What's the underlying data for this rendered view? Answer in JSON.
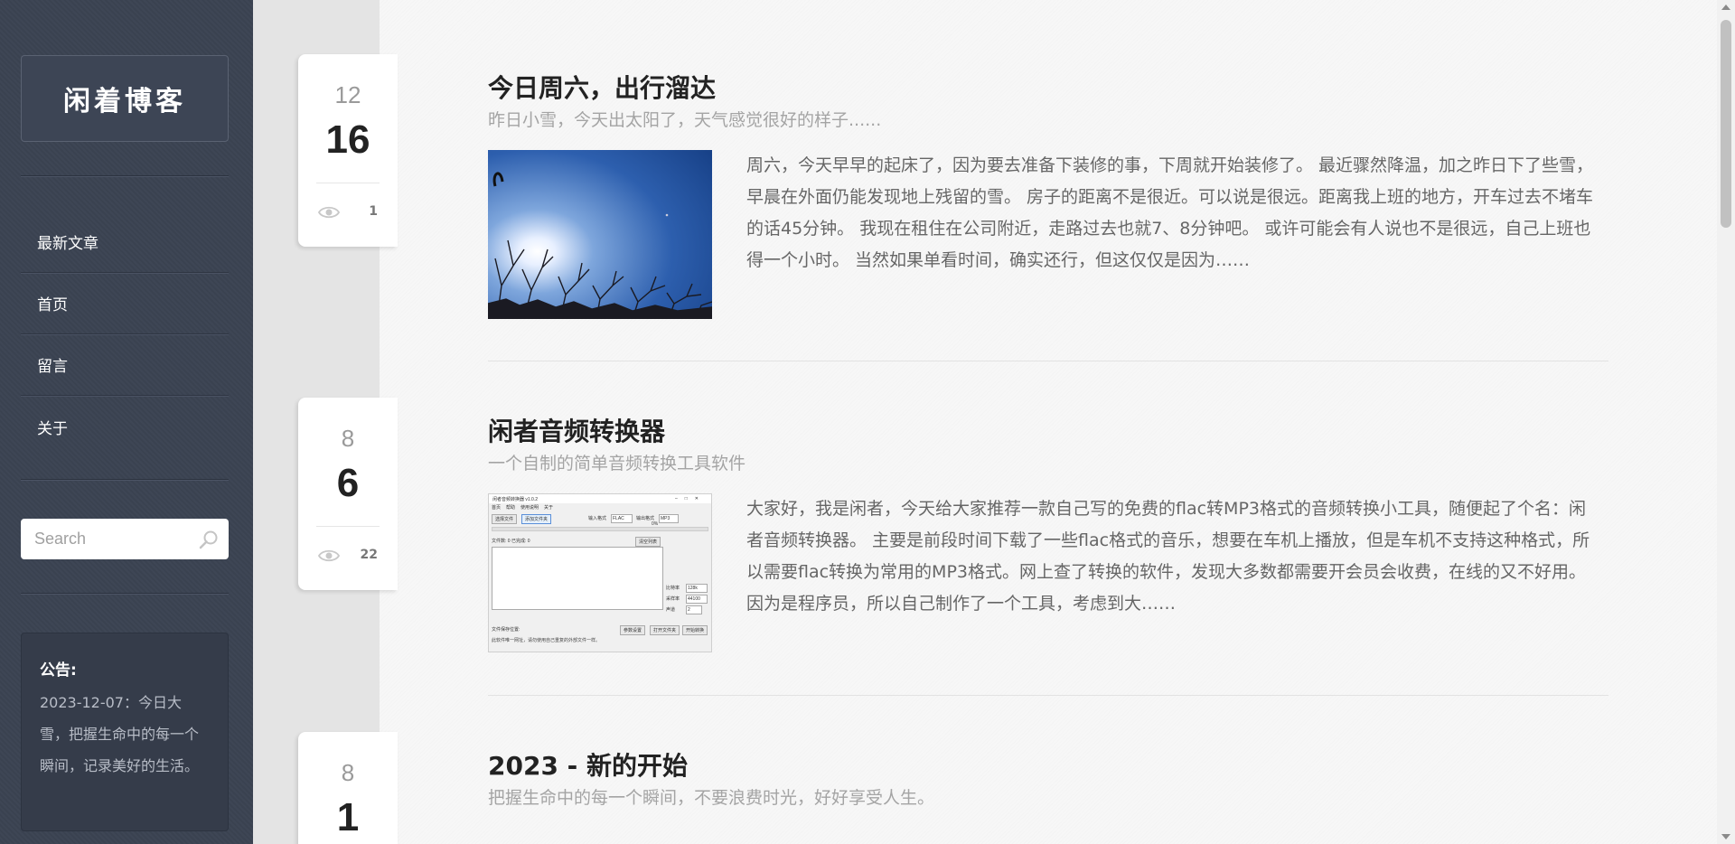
{
  "sidebar": {
    "logo": "闲着博客",
    "nav": [
      {
        "label": "最新文章"
      },
      {
        "label": "首页"
      },
      {
        "label": "留言"
      },
      {
        "label": "关于"
      }
    ],
    "search": {
      "placeholder": "Search",
      "icon": "search-icon"
    },
    "notice": {
      "title": "公告:",
      "body": "2023-12-07：今日大雪，把握生命中的每一个瞬间，记录美好的生活。"
    }
  },
  "posts": [
    {
      "month": "12",
      "day": "16",
      "views": "1",
      "title": "今日周六，出行溜达",
      "subtitle": "昨日小雪，今天出太阳了，天气感觉很好的样子......",
      "excerpt": "周六，今天早早的起床了，因为要去准备下装修的事，下周就开始装修了。 最近骤然降温，加之昨日下了些雪，早晨在外面仍能发现地上残留的雪。 房子的距离不是很近。可以说是很远。距离我上班的地方，开车过去不堵车的话45分钟。 我现在租住在公司附近，走路过去也就7、8分钟吧。 或许可能会有人说也不是很远，自己上班也得一个小时。 当然如果单看时间，确实还行，但这仅仅是因为……"
    },
    {
      "month": "8",
      "day": "6",
      "views": "22",
      "title": "闲者音频转换器",
      "subtitle": "一个自制的简单音频转换工具软件",
      "excerpt": "大家好，我是闲者，今天给大家推荐一款自己写的免费的flac转MP3格式的音频转换小工具，随便起了个名：闲者音频转换器。 主要是前段时间下载了一些flac格式的音乐，想要在车机上播放，但是车机不支持这种格式，所以需要flac转换为常用的MP3格式。网上查了转换的软件，发现大多数都需要开会员会收费，在线的又不好用。 因为是程序员，所以自己制作了一个工具，考虑到大……",
      "app_window": {
        "title": "闲者音频转换器 v1.0.2",
        "menu": [
          "首页",
          "帮助",
          "使用说明",
          "关于"
        ],
        "btn_select_file": "选择文件",
        "btn_add_folder": "添加文件夹",
        "input_format_label": "输入格式",
        "input_format_value": "FLAC",
        "output_format_label": "输出格式",
        "output_format_value": "MP3",
        "progress": "0%",
        "file_count": "文件数: 0  已完成: 0",
        "btn_clear": "清空列表",
        "bitrate_label": "比特率",
        "bitrate_value": "128k",
        "samplerate_label": "采样率",
        "samplerate_value": "44100",
        "channels_label": "声道",
        "channels_value": "2",
        "output_dir_label": "文件保存位置:",
        "btn_settings": "参数设置",
        "btn_open_folder": "打开文件夹",
        "btn_start": "开始转换",
        "footer_note": "此软件唯一网址，请勿使用自己重复的外部文件一样。"
      }
    },
    {
      "month": "8",
      "day": "1",
      "views": "",
      "title": "2023 - 新的开始",
      "subtitle": "把握生命中的每一个瞬间，不要浪费时光，好好享受人生。",
      "excerpt": ""
    }
  ]
}
